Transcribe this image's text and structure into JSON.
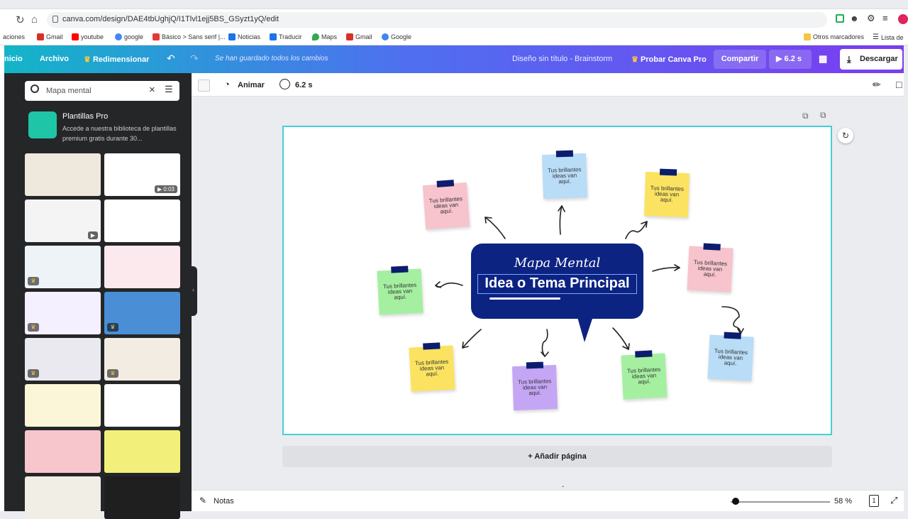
{
  "browser": {
    "url": "canva.com/design/DAE4tbUghjQ/I1Tlvl1ejj5BS_GSyzt1yQ/edit",
    "bookmarks": [
      {
        "label": "aciones",
        "color": "#888"
      },
      {
        "label": "Gmail",
        "color": "#d93025"
      },
      {
        "label": "youtube",
        "color": "#ff0000"
      },
      {
        "label": "google",
        "color": "#4285f4"
      },
      {
        "label": "Básico > Sans serif |...",
        "color": "#e53935"
      },
      {
        "label": "Noticias",
        "color": "#1a73e8"
      },
      {
        "label": "Traducir",
        "color": "#1a73e8"
      },
      {
        "label": "Maps",
        "color": "#34a853"
      },
      {
        "label": "Gmail",
        "color": "#d93025"
      },
      {
        "label": "Google",
        "color": "#4285f4"
      }
    ],
    "other_bookmarks": "Otros marcadores",
    "reading_list": "Lista de"
  },
  "header": {
    "home": "nicio",
    "file": "Archivo",
    "resize": "Redimensionar",
    "saved_status": "Se han guardado todos los cambios",
    "doc_title": "Diseño sin título - Brainstorm",
    "try_pro": "Probar Canva Pro",
    "share": "Compartir",
    "play_duration": "6.2 s",
    "download": "Descargar"
  },
  "left_panel": {
    "search_value": "Mapa mental",
    "pro_title": "Plantillas Pro",
    "pro_desc": "Accede a nuestra biblioteca de plantillas premium gratis durante 30...",
    "templates": [
      {
        "bg": "#efe8dc",
        "badge": ""
      },
      {
        "bg": "#ffffff",
        "badge": "0:03"
      },
      {
        "bg": "#f4f4f4",
        "badge": "video"
      },
      {
        "bg": "#ffffff",
        "badge": ""
      },
      {
        "bg": "#eef3f8",
        "badge": "crown"
      },
      {
        "bg": "#fbe9ee",
        "badge": ""
      },
      {
        "bg": "#f5f0ff",
        "badge": "crown"
      },
      {
        "bg": "#4a8fd6",
        "badge": "crown"
      },
      {
        "bg": "#e9e9ef",
        "badge": "crown"
      },
      {
        "bg": "#f3ece2",
        "badge": "crown"
      },
      {
        "bg": "#fbf6d8",
        "badge": ""
      },
      {
        "bg": "#ffffff",
        "badge": ""
      },
      {
        "bg": "#f7c6cc",
        "badge": ""
      },
      {
        "bg": "#f2f07a",
        "badge": ""
      },
      {
        "bg": "#f1eee6",
        "badge": ""
      },
      {
        "bg": "#1f1f1f",
        "badge": ""
      }
    ]
  },
  "toolbar": {
    "animate": "Animar",
    "duration": "6.2 s"
  },
  "canvas": {
    "script_title": "Mapa Mental",
    "main_title": "Idea o Tema Principal",
    "notes": [
      {
        "text": "Tus brillantes ideas van aquí.",
        "color": "#f7c3cd"
      },
      {
        "text": "Tus brillantes ideas van aquí.",
        "color": "#b9dcf7"
      },
      {
        "text": "Tus brillantes ideas van aquí.",
        "color": "#fbe361"
      },
      {
        "text": "Tus brillantes ideas van aquí.",
        "color": "#a4f0a0"
      },
      {
        "text": "Tus brillantes ideas van aquí.",
        "color": "#f7c3cd"
      },
      {
        "text": "Tus brillantes ideas van aquí.",
        "color": "#b9dcf7"
      },
      {
        "text": "Tus brillantes ideas van aquí.",
        "color": "#fbe361"
      },
      {
        "text": "Tus brillantes ideas van aquí.",
        "color": "#c4a6f5"
      },
      {
        "text": "Tus brillantes ideas van aquí.",
        "color": "#a4f0a0"
      }
    ],
    "add_page": "+ Añadir página"
  },
  "bottom": {
    "notes": "Notas",
    "zoom": "58 %",
    "zoom_level": 0.05,
    "page_number": "1"
  }
}
